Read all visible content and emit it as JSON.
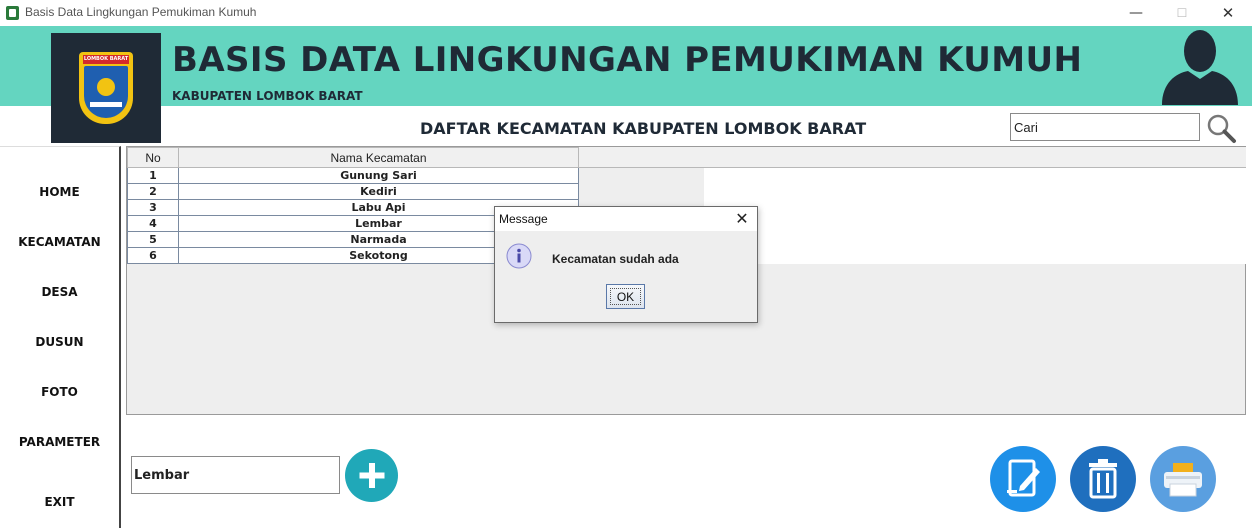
{
  "window": {
    "title": "Basis Data Lingkungan Pemukiman Kumuh",
    "minimize_glyph": "—",
    "maximize_glyph": "☐",
    "close_glyph": "✕"
  },
  "header": {
    "title": "BASIS DATA LINGKUNGAN PEMUKIMAN KUMUH",
    "subtitle": "KABUPATEN LOMBOK BARAT",
    "logo_band_text": "LOMBOK BARAT",
    "accent_color": "#64d5c0",
    "logo_bg_color": "#1f2a36"
  },
  "sidebar": {
    "items": [
      {
        "label": "HOME"
      },
      {
        "label": "KECAMATAN"
      },
      {
        "label": "DESA"
      },
      {
        "label": "DUSUN"
      },
      {
        "label": "FOTO"
      },
      {
        "label": "PARAMETER"
      },
      {
        "label": "EXIT"
      }
    ]
  },
  "main": {
    "heading": "DAFTAR KECAMATAN KABUPATEN LOMBOK BARAT",
    "search": {
      "value": "Cari",
      "icon": "search-icon"
    },
    "table": {
      "columns": [
        "No",
        "Nama Kecamatan"
      ],
      "rows": [
        [
          "1",
          "Gunung Sari"
        ],
        [
          "2",
          "Kediri"
        ],
        [
          "3",
          "Labu Api"
        ],
        [
          "4",
          "Lembar"
        ],
        [
          "5",
          "Narmada"
        ],
        [
          "6",
          "Sekotong"
        ]
      ]
    },
    "input": {
      "value": "Lembar"
    },
    "buttons": {
      "add": {
        "icon": "plus-icon",
        "color": "#20a8b8"
      },
      "edit": {
        "icon": "edit-icon",
        "color": "#1e90e8"
      },
      "delete": {
        "icon": "trash-icon",
        "color": "#1f6fbe"
      },
      "print": {
        "icon": "printer-icon",
        "color": "#5a9fe0"
      }
    }
  },
  "dialog": {
    "title": "Message",
    "message": "Kecamatan sudah ada",
    "ok_label": "OK",
    "close_glyph": "✕",
    "icon": "info-icon"
  }
}
